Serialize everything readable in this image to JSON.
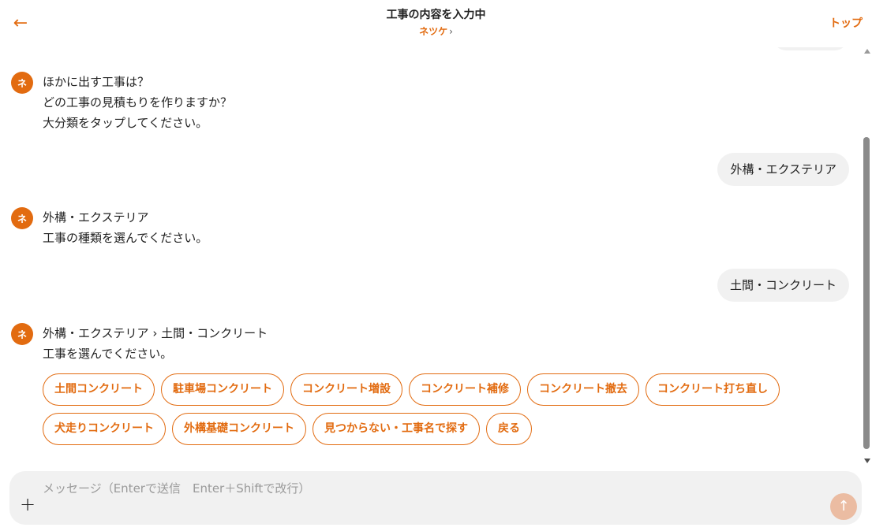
{
  "header": {
    "back_icon": "←",
    "title": "工事の内容を入力中",
    "subtitle": "ネツケ",
    "subtitle_chevron": "›",
    "top_link": "トップ"
  },
  "messages": [
    {
      "role": "bot",
      "avatar": "ネ",
      "lines": [
        "ほかに出す工事は？",
        "どの工事の見積もりを作りますか？",
        "大分類をタップしてください。"
      ]
    },
    {
      "role": "user",
      "text": "外構・エクステリア"
    },
    {
      "role": "bot",
      "avatar": "ネ",
      "lines": [
        "外構・エクステリア",
        "工事の種類を選んでください。"
      ]
    },
    {
      "role": "user",
      "text": "土間・コンクリート"
    },
    {
      "role": "bot",
      "avatar": "ネ",
      "lines": [
        "外構・エクステリア › 土間・コンクリート",
        "工事を選んでください。"
      ]
    }
  ],
  "choices": {
    "row1": [
      "土間コンクリート",
      "駐車場コンクリート",
      "コンクリート増設",
      "コンクリート補修",
      "コンクリート撤去",
      "コンクリート打ち直し"
    ],
    "row2": [
      "犬走りコンクリート",
      "外構基礎コンクリート",
      "見つからない・工事名で探す",
      "戻る"
    ]
  },
  "composer": {
    "placeholder": "メッセージ（Enterで送信　Enter＋Shiftで改行）",
    "plus_icon": "+",
    "send_icon": "↑"
  },
  "colors": {
    "accent": "#e26b10",
    "bubble": "#f1f1f1",
    "send_disabled": "#ebbca2"
  }
}
